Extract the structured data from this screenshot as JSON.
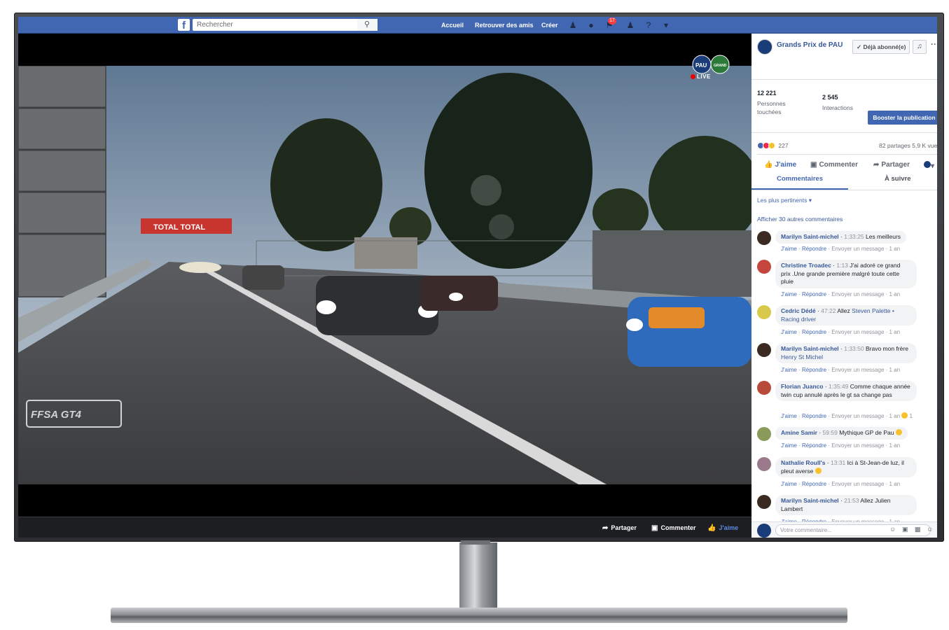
{
  "topbar": {
    "search_placeholder": "Rechercher",
    "nav": [
      "Accueil",
      "Retrouver des amis",
      "Créer"
    ],
    "notification_count": "17"
  },
  "video": {
    "live_label": "LIVE",
    "actions": {
      "share": "Partager",
      "comment": "Commenter",
      "like": "J'aime"
    }
  },
  "page": {
    "name": "Grands Prix de PAU",
    "subscribed_label": "Déjà abonné(e)"
  },
  "stats": {
    "reach_value": "12 221",
    "reach_label": "Personnes touchées",
    "interactions_value": "2 545",
    "interactions_label": "Interactions",
    "boost_label": "Booster la publication"
  },
  "reactions": {
    "count": "227",
    "shares_views": "82 partages  5,9 K vues"
  },
  "post_actions": {
    "like": "J'aime",
    "comment": "Commenter",
    "share": "Partager"
  },
  "tabs": {
    "comments": "Commentaires",
    "next": "À suivre"
  },
  "comments_section": {
    "sort_label": "Les plus pertinents ▾",
    "more_label": "Afficher 30 autres commentaires",
    "meta_like": "J'aime",
    "meta_reply": "Répondre",
    "meta_message": "Envoyer un message",
    "items": [
      {
        "author": "Marilyn Saint-michel",
        "time": "1:33:25",
        "text": "Les meilleurs",
        "age": "1 an"
      },
      {
        "author": "Christine Troadec",
        "time": "1:13",
        "text": "J'ai adoré ce grand prix .Une grande première malgré toute cette pluie",
        "age": "1 an"
      },
      {
        "author": "Cedric Dédé",
        "time": "47:22",
        "text": "Allez",
        "link": "Steven Palette • Racing driver",
        "age": "1 an"
      },
      {
        "author": "Marilyn Saint-michel",
        "time": "1:33:50",
        "text": "Bravo mon frère",
        "link": "Henry St Michel",
        "age": "1 an"
      },
      {
        "author": "Florian Juanco",
        "time": "1:35:49",
        "text": "Comme chaque année twin cup annulé après le gt sa change pas",
        "age": "1 an",
        "reaction_count": "1"
      },
      {
        "author": "Amine Samir",
        "time": "59:59",
        "text": "Mythique GP de Pau",
        "age": "1 an"
      },
      {
        "author": "Nathalie Roull's",
        "time": "13:31",
        "text": "Ici à St-Jean-de luz, il pleut averse",
        "age": "1 an"
      },
      {
        "author": "Marilyn Saint-michel",
        "time": "21:53",
        "text": "Allez Julien Lambert",
        "age": "1 an"
      }
    ]
  },
  "compose": {
    "placeholder": "Votre commentaire..."
  },
  "colors": {
    "facebook_blue": "#4267b2",
    "link_blue": "#385898",
    "live_red": "#e00000"
  }
}
